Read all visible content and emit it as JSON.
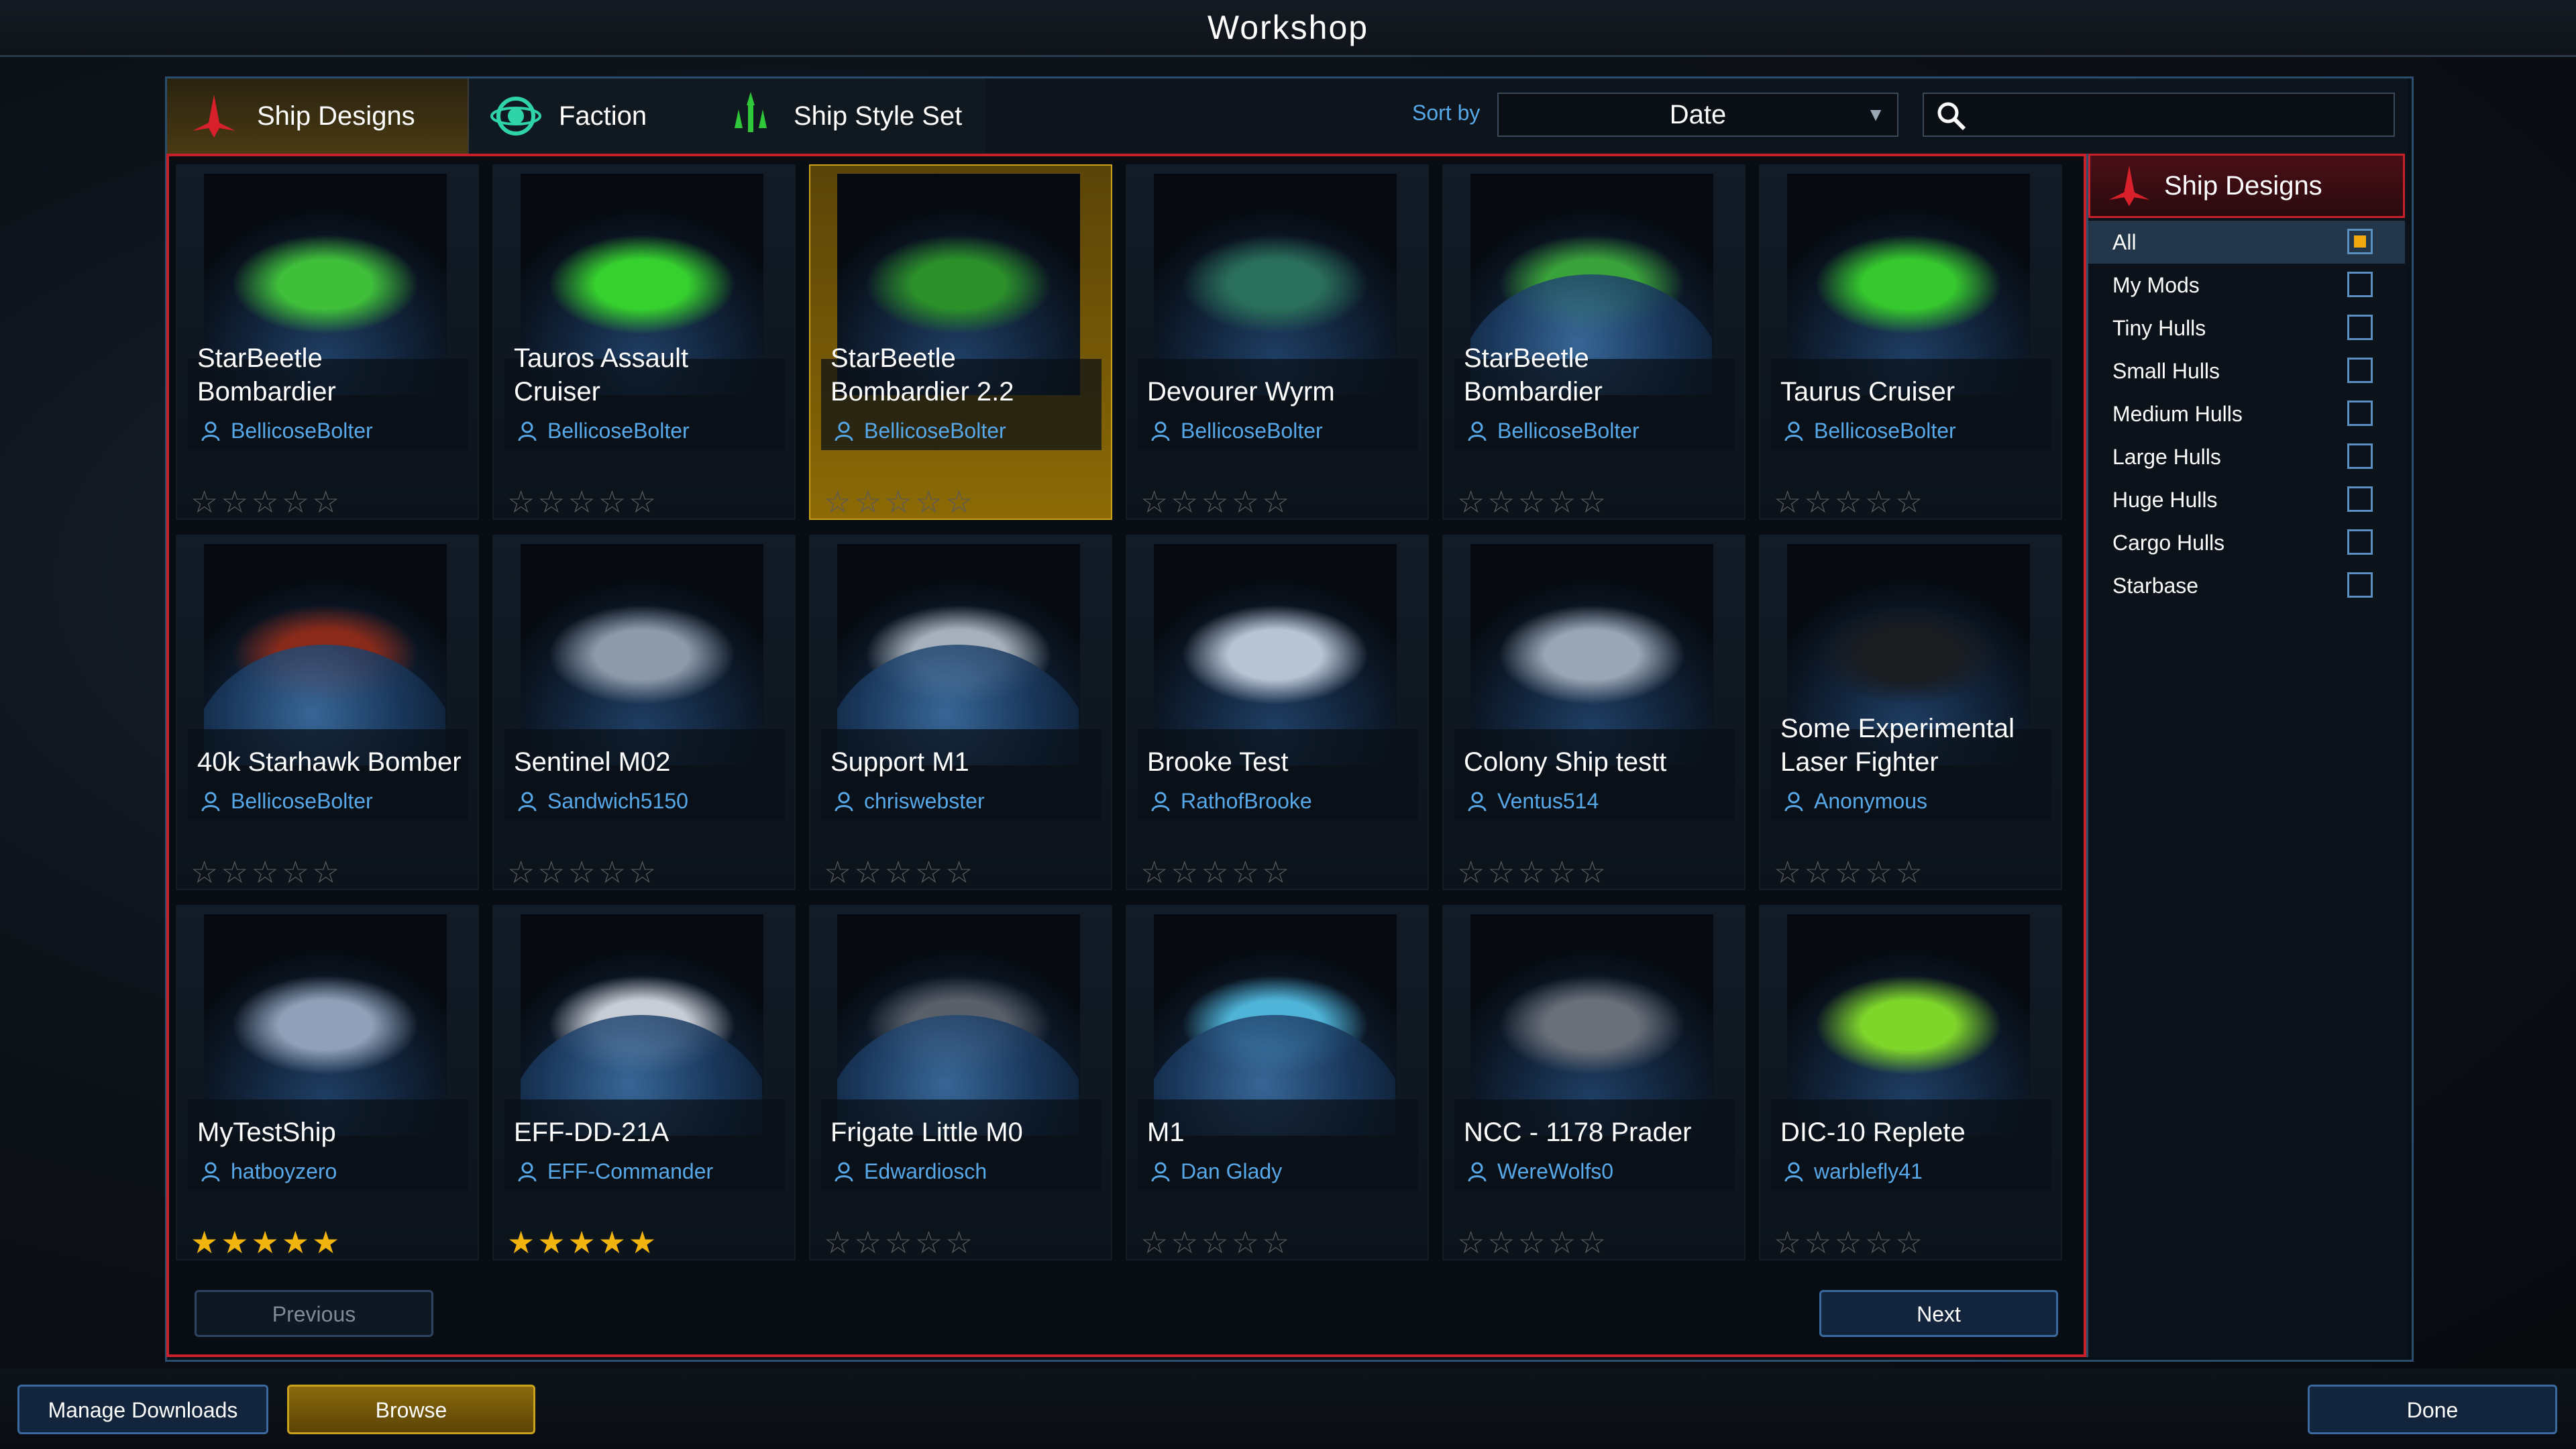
{
  "title": "Workshop",
  "tabs": [
    {
      "label": "Ship Designs",
      "icon": "ship-designs-icon",
      "active": true
    },
    {
      "label": "Faction",
      "icon": "faction-icon"
    },
    {
      "label": "Ship Style Set",
      "icon": "ship-style-set-icon"
    }
  ],
  "sort": {
    "label": "Sort by",
    "value": "Date"
  },
  "search": {
    "placeholder": ""
  },
  "cards": [
    {
      "name": "StarBeetle Bombardier",
      "author": "BellicoseBolter",
      "rating": 0,
      "ship_color": "#3fbf3a"
    },
    {
      "name": "Tauros Assault Cruiser",
      "author": "BellicoseBolter",
      "rating": 0,
      "ship_color": "#36d12e"
    },
    {
      "name": "StarBeetle Bombardier 2.2",
      "author": "BellicoseBolter",
      "rating": 0,
      "ship_color": "#2b8f2a",
      "selected": true
    },
    {
      "name": "Devourer Wyrm",
      "author": "BellicoseBolter",
      "rating": 0,
      "ship_color": "#2a6f5a"
    },
    {
      "name": "StarBeetle Bombardier",
      "author": "BellicoseBolter",
      "rating": 0,
      "ship_color": "#3aa23a",
      "planet": true
    },
    {
      "name": "Taurus Cruiser",
      "author": "BellicoseBolter",
      "rating": 0,
      "ship_color": "#36c82e"
    },
    {
      "name": "40k Starhawk Bomber",
      "author": "BellicoseBolter",
      "rating": 0,
      "ship_color": "#8a2a1a",
      "planet": true
    },
    {
      "name": "Sentinel M02",
      "author": "Sandwich5150",
      "rating": 0,
      "ship_color": "#8d9aaa"
    },
    {
      "name": "Support M1",
      "author": "chriswebster",
      "rating": 0,
      "ship_color": "#a6b0ba",
      "planet": true
    },
    {
      "name": "Brooke Test",
      "author": "RathofBrooke",
      "rating": 0,
      "ship_color": "#b8c4d4"
    },
    {
      "name": "Colony Ship testt",
      "author": "Ventus514",
      "rating": 0,
      "ship_color": "#9aa6b4"
    },
    {
      "name": "Some Experimental Laser Fighter",
      "author": "Anonymous",
      "rating": 0,
      "ship_color": "#1a1c20"
    },
    {
      "name": "MyTestShip",
      "author": "hatboyzero",
      "rating": 5,
      "ship_color": "#8fa0b8"
    },
    {
      "name": "EFF-DD-21A",
      "author": "EFF-Commander",
      "rating": 5,
      "ship_color": "#c8ccd4",
      "planet": true
    },
    {
      "name": "Frigate Little M0",
      "author": "Edwardiosch",
      "rating": 0,
      "ship_color": "#5a606a",
      "planet": true
    },
    {
      "name": "M1",
      "author": "Dan Glady",
      "rating": 0,
      "ship_color": "#4fb4d8",
      "planet": true
    },
    {
      "name": "NCC - 1178 Prader",
      "author": "WereWolfs0",
      "rating": 0,
      "ship_color": "#6a707a"
    },
    {
      "name": "DIC-10 Replete",
      "author": "warblefly41",
      "rating": 0,
      "ship_color": "#7fd62a"
    }
  ],
  "filter": {
    "title": "Ship Designs",
    "items": [
      {
        "label": "All",
        "checked": true
      },
      {
        "label": "My Mods",
        "checked": false
      },
      {
        "label": "Tiny Hulls",
        "checked": false
      },
      {
        "label": "Small Hulls",
        "checked": false
      },
      {
        "label": "Medium Hulls",
        "checked": false
      },
      {
        "label": "Large Hulls",
        "checked": false
      },
      {
        "label": "Huge Hulls",
        "checked": false
      },
      {
        "label": "Cargo Hulls",
        "checked": false
      },
      {
        "label": "Starbase",
        "checked": false
      }
    ]
  },
  "pagination": {
    "prev": "Previous",
    "next": "Next"
  },
  "footer": {
    "manage": "Manage Downloads",
    "browse": "Browse",
    "done": "Done"
  },
  "colors": {
    "accent_red": "#c8202a",
    "link_blue": "#56a8e8",
    "star_gold": "#f1b40d",
    "selected_gold": "#8c6a06"
  }
}
